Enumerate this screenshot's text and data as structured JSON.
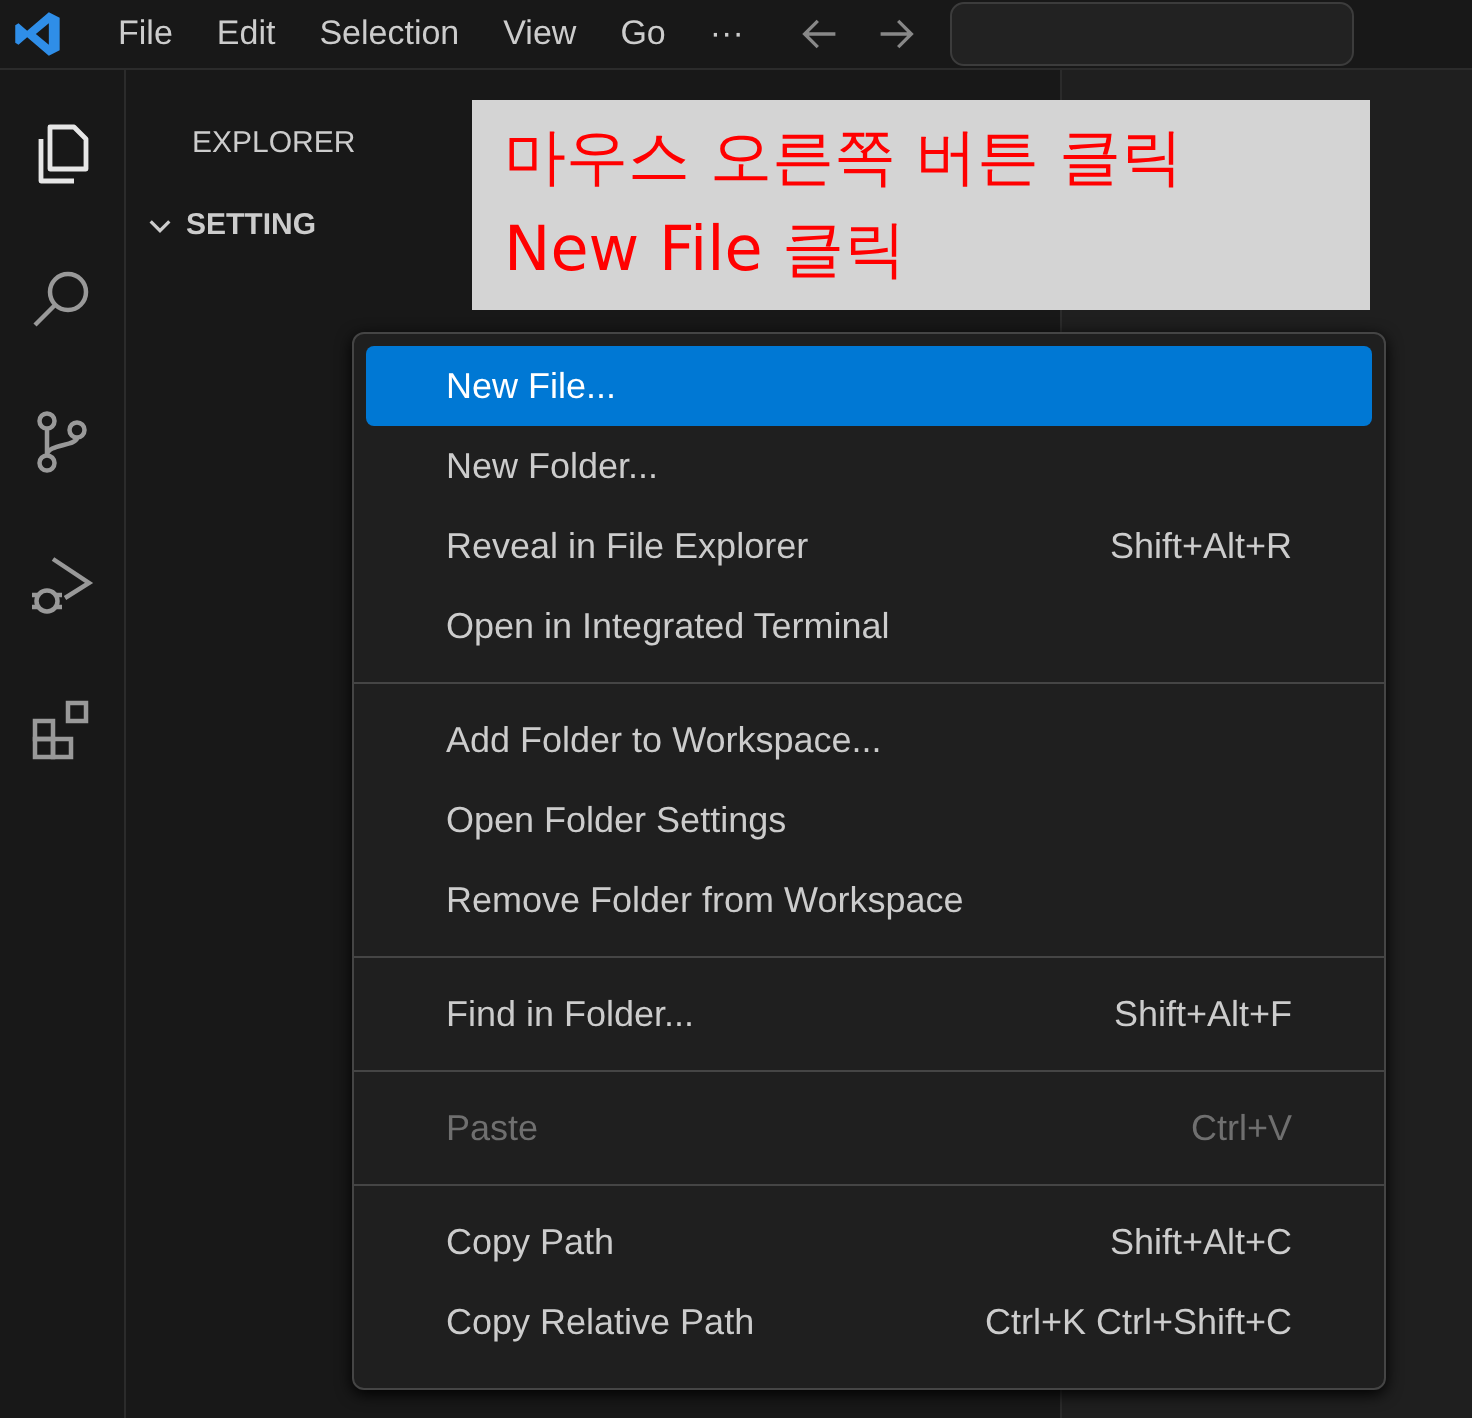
{
  "menu_bar": {
    "items": [
      "File",
      "Edit",
      "Selection",
      "View",
      "Go",
      "···"
    ]
  },
  "sidebar": {
    "title": "EXPLORER",
    "folder": {
      "name": "SETTING",
      "expanded": true
    }
  },
  "annotation": {
    "lines": [
      "마우스 오른쪽 버튼 클릭",
      "New File 클릭"
    ]
  },
  "context_menu": {
    "groups": [
      [
        {
          "label": "New File...",
          "selected": true,
          "disabled": false
        },
        {
          "label": "New Folder...",
          "selected": false,
          "disabled": false
        },
        {
          "label": "Reveal in File Explorer",
          "shortcut": "Shift+Alt+R",
          "selected": false,
          "disabled": false
        },
        {
          "label": "Open in Integrated Terminal",
          "selected": false,
          "disabled": false
        }
      ],
      [
        {
          "label": "Add Folder to Workspace...",
          "selected": false,
          "disabled": false
        },
        {
          "label": "Open Folder Settings",
          "selected": false,
          "disabled": false
        },
        {
          "label": "Remove Folder from Workspace",
          "selected": false,
          "disabled": false
        }
      ],
      [
        {
          "label": "Find in Folder...",
          "shortcut": "Shift+Alt+F",
          "selected": false,
          "disabled": false
        }
      ],
      [
        {
          "label": "Paste",
          "shortcut": "Ctrl+V",
          "selected": false,
          "disabled": true
        }
      ],
      [
        {
          "label": "Copy Path",
          "shortcut": "Shift+Alt+C",
          "selected": false,
          "disabled": false
        },
        {
          "label": "Copy Relative Path",
          "shortcut": "Ctrl+K Ctrl+Shift+C",
          "selected": false,
          "disabled": false
        }
      ]
    ]
  }
}
